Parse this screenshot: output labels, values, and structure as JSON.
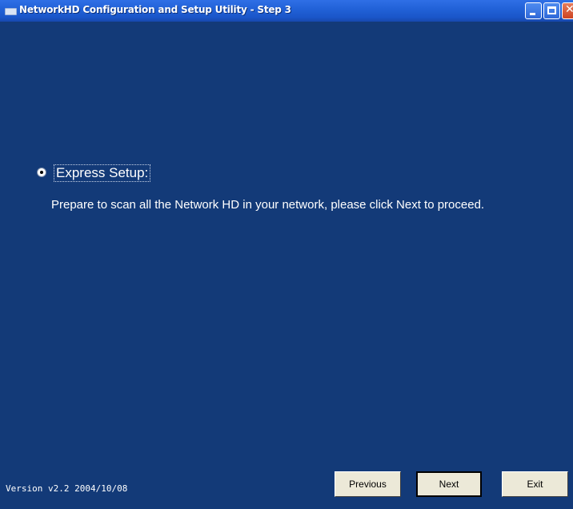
{
  "window": {
    "title": "NetworkHD Configuration and Setup Utility - Step 3",
    "icon": "app-icon",
    "controls": [
      "minimize-icon",
      "maximize-icon",
      "close-icon"
    ]
  },
  "content": {
    "option_label": "Express Setup:",
    "option_selected": true,
    "description": "Prepare to scan all the Network HD in your network, please click Next to proceed."
  },
  "footer": {
    "version": "Version v2.2  2004/10/08",
    "previous_label": "Previous",
    "next_label": "Next",
    "exit_label": "Exit"
  },
  "colors": {
    "background": "#133a78",
    "titlebar": "#2262d8",
    "button_face": "#ece9d8"
  }
}
